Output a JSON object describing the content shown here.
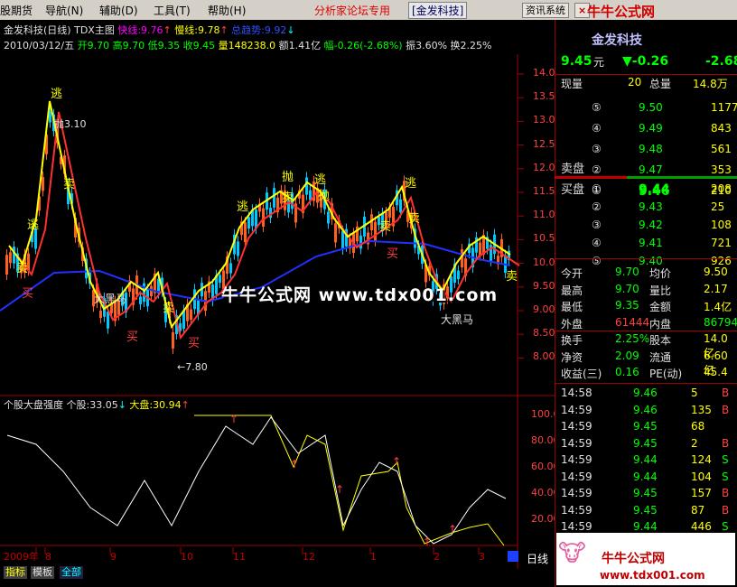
{
  "menu": {
    "items": [
      "股期货",
      "导航(N)",
      "辅助(D)",
      "工具(T)",
      "帮助(H)"
    ],
    "forum": "分析家论坛专用",
    "company": "[金发科技]",
    "btn_info": "资讯系统",
    "btn_close": "×",
    "brand": "牛牛公式网"
  },
  "header": {
    "stock": "金发科技(日线)",
    "main": "TDX主图",
    "fast_label": "快线:9.76",
    "slow_label": "慢线:9.78",
    "total_label": "总趋势:9.92",
    "date": "2010/03/12/五",
    "open": "开9.70",
    "high": "高9.70",
    "low": "低9.35",
    "close": "收9.45",
    "vol": "量148238.0",
    "amount": "额1.41亿",
    "change": "幅-0.26(-2.68%)",
    "amp": "振3.60%",
    "turn": "换2.25%"
  },
  "indicator": {
    "name": "个股大盘强度",
    "stock_label": "个股:33.05",
    "market_label": "大盘:30.94"
  },
  "price_axis": [
    "14.00",
    "13.50",
    "13.00",
    "12.50",
    "12.00",
    "11.50",
    "11.00",
    "10.50",
    "10.00",
    "9.50",
    "9.00",
    "8.50",
    "8.00"
  ],
  "ind_axis": [
    "100.00",
    "80.00",
    "60.00",
    "40.00",
    "20.00"
  ],
  "time_axis": [
    "2009年",
    "8",
    "9",
    "10",
    "11",
    "12",
    "1",
    "2",
    "3"
  ],
  "annotations": {
    "dump": "抛3.10",
    "low_mark": "←7.80",
    "dark_horse": "大黑马",
    "escape": "逃",
    "sell": "卖",
    "buy": "买",
    "throw": "抛"
  },
  "bottom_tabs": [
    "指标",
    "模板",
    "全部"
  ],
  "daily_label": "日线",
  "watermark": "牛牛公式网 www.tdx001.com",
  "panel": {
    "title": "金发科技",
    "price": "9.45",
    "unit": "元",
    "change": "▼-0.26",
    "pct": "-2.68",
    "now_vol_label": "现量",
    "now_vol": "20",
    "total_vol_label": "总量",
    "total_vol": "14.8万",
    "sell_label": "卖盘",
    "buy_label": "买盘",
    "asks": [
      {
        "lvl": "⑤",
        "price": "9.50",
        "vol": "1177"
      },
      {
        "lvl": "④",
        "price": "9.49",
        "vol": "843"
      },
      {
        "lvl": "③",
        "price": "9.48",
        "vol": "561"
      },
      {
        "lvl": "②",
        "price": "9.47",
        "vol": "353"
      },
      {
        "lvl": "①",
        "price": "9.46",
        "vol": "210"
      }
    ],
    "bids": [
      {
        "lvl": "①",
        "price": "9.44",
        "vol": "208"
      },
      {
        "lvl": "②",
        "price": "9.43",
        "vol": "25"
      },
      {
        "lvl": "③",
        "price": "9.42",
        "vol": "108"
      },
      {
        "lvl": "④",
        "price": "9.41",
        "vol": "721"
      },
      {
        "lvl": "⑤",
        "price": "9.40",
        "vol": "926"
      }
    ],
    "stats": [
      [
        "今开",
        "9.70",
        "均价",
        "9.50"
      ],
      [
        "最高",
        "9.70",
        "量比",
        "2.17"
      ],
      [
        "最低",
        "9.35",
        "金额",
        "1.4亿"
      ],
      [
        "外盘",
        "61444",
        "内盘",
        "86794"
      ],
      [
        "换手",
        "2.25%",
        "股本",
        "14.0亿"
      ],
      [
        "净资",
        "2.09",
        "流通",
        "6.60亿"
      ],
      [
        "收益(三)",
        "0.16",
        "PE(动)",
        "45.4"
      ]
    ],
    "ticks": [
      [
        "14:58",
        "9.46",
        "5",
        "B"
      ],
      [
        "14:59",
        "9.46",
        "135",
        "B"
      ],
      [
        "14:59",
        "9.45",
        "68",
        ""
      ],
      [
        "14:59",
        "9.45",
        "2",
        "B"
      ],
      [
        "14:59",
        "9.44",
        "124",
        "S"
      ],
      [
        "14:59",
        "9.44",
        "104",
        "S"
      ],
      [
        "14:59",
        "9.45",
        "157",
        "B"
      ],
      [
        "14:59",
        "9.45",
        "87",
        "B"
      ],
      [
        "14:59",
        "9.44",
        "446",
        "S"
      ]
    ],
    "brand": "牛牛公式网",
    "brand_url": "www.tdx001.com"
  },
  "colors": {
    "up": "#ff4040",
    "down": "#00ff00",
    "fast": "#ffff00",
    "slow": "#ff3030",
    "total": "#2030ff",
    "candle_up": "#ff6020",
    "candle_dn": "#00c8ff"
  }
}
